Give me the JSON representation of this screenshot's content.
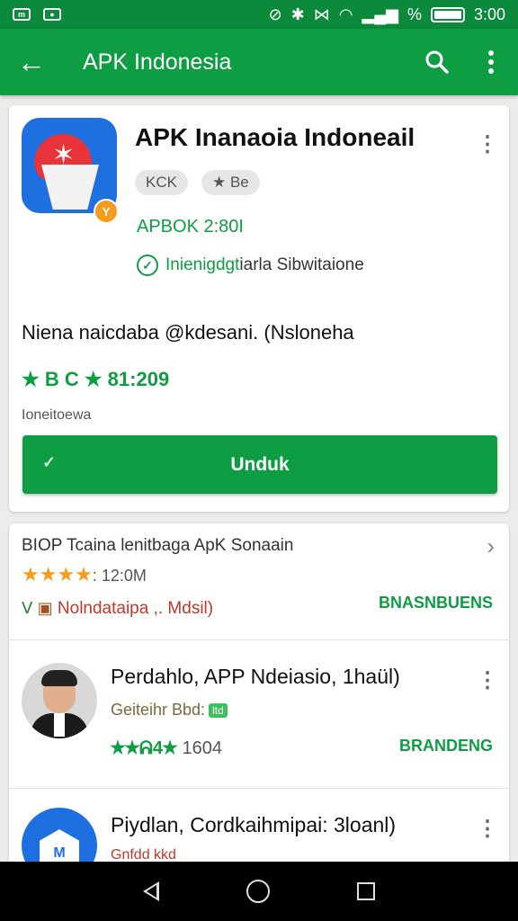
{
  "status": {
    "time": "3:00",
    "battery_label": "%"
  },
  "appbar": {
    "title": "APK Indonesia",
    "icons": [
      "back-arrow-icon",
      "search-icon",
      "overflow-menu-icon"
    ]
  },
  "app": {
    "title": "APK Inanaoia Indoneail",
    "chips": [
      "KCK",
      "★ Be"
    ],
    "version": "APBOK 2:80I",
    "verified_green": "Inienigdgt",
    "verified_rest": "iarla Sibwitaione",
    "description": "Niena naicdaba @kdesani. (Nsloneha",
    "rating_text": "★ B C ★ 81:209",
    "meta": "Ioneitoewa",
    "download_label": "Unduk"
  },
  "section": {
    "title": "BIOP Tcaina lenitbaga ApK Sonaain",
    "stars": "★★★★",
    "size": ": 12:0M",
    "developer": "Nolndataipa ,. Mdsil)",
    "tag": "BNASNBUENS"
  },
  "list": [
    {
      "title": "Perdahlo, APP Ndeiasio, 1haül)",
      "subtitle": "Geiteihr Bbd:",
      "subtitle_tag": "ltd",
      "rating_stars": "★★ᕱ4★",
      "rating_num": "1604",
      "tag": "BRANDENG"
    },
    {
      "title": "Piydlan, Cordkaihmipai: 3loanl)",
      "subtitle": "Gnfdd kkd"
    }
  ],
  "colors": {
    "primary": "#0f9d44",
    "statusbar": "#0a8a3a",
    "accent_orange": "#f39c1e"
  }
}
